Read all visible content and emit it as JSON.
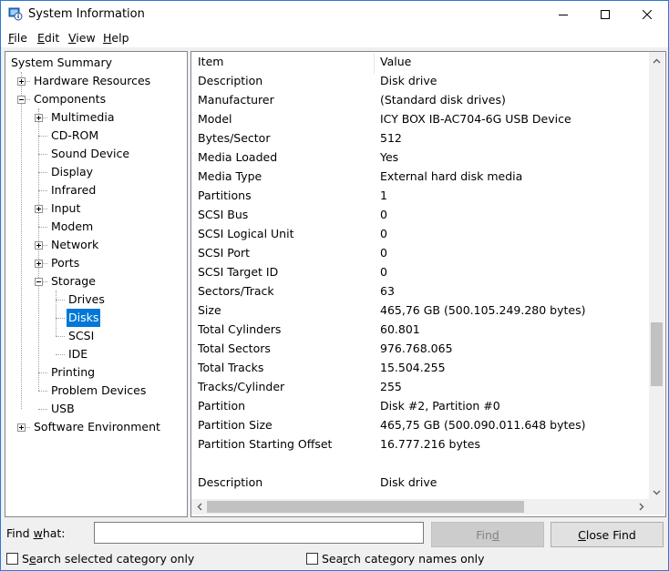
{
  "window": {
    "title": "System Information"
  },
  "menu": [
    "File",
    "Edit",
    "View",
    "Help"
  ],
  "tree": [
    {
      "label": "System Summary"
    },
    {
      "label": "Hardware Resources",
      "expander": "plus"
    },
    {
      "label": "Components",
      "expander": "minus"
    },
    {
      "label": "Multimedia",
      "expander": "plus"
    },
    {
      "label": "CD-ROM"
    },
    {
      "label": "Sound Device"
    },
    {
      "label": "Display"
    },
    {
      "label": "Infrared"
    },
    {
      "label": "Input",
      "expander": "plus"
    },
    {
      "label": "Modem"
    },
    {
      "label": "Network",
      "expander": "plus"
    },
    {
      "label": "Ports",
      "expander": "plus"
    },
    {
      "label": "Storage",
      "expander": "minus"
    },
    {
      "label": "Drives"
    },
    {
      "label": "Disks",
      "selected": true
    },
    {
      "label": "SCSI"
    },
    {
      "label": "IDE"
    },
    {
      "label": "Printing"
    },
    {
      "label": "Problem Devices"
    },
    {
      "label": "USB"
    },
    {
      "label": "Software Environment",
      "expander": "plus"
    }
  ],
  "table": {
    "headers": [
      "Item",
      "Value"
    ],
    "rows": [
      [
        "Description",
        "Disk drive"
      ],
      [
        "Manufacturer",
        "(Standard disk drives)"
      ],
      [
        "Model",
        "ICY BOX IB-AC704-6G USB Device"
      ],
      [
        "Bytes/Sector",
        "512"
      ],
      [
        "Media Loaded",
        "Yes"
      ],
      [
        "Media Type",
        "External hard disk media"
      ],
      [
        "Partitions",
        "1"
      ],
      [
        "SCSI Bus",
        "0"
      ],
      [
        "SCSI Logical Unit",
        "0"
      ],
      [
        "SCSI Port",
        "0"
      ],
      [
        "SCSI Target ID",
        "0"
      ],
      [
        "Sectors/Track",
        "63"
      ],
      [
        "Size",
        "465,76 GB (500.105.249.280 bytes)"
      ],
      [
        "Total Cylinders",
        "60.801"
      ],
      [
        "Total Sectors",
        "976.768.065"
      ],
      [
        "Total Tracks",
        "15.504.255"
      ],
      [
        "Tracks/Cylinder",
        "255"
      ],
      [
        "Partition",
        "Disk #2, Partition #0"
      ],
      [
        "Partition Size",
        "465,75 GB (500.090.011.648 bytes)"
      ],
      [
        "Partition Starting Offset",
        "16.777.216 bytes"
      ],
      [
        "",
        ""
      ],
      [
        "Description",
        "Disk drive"
      ]
    ]
  },
  "find": {
    "label": "Find what:",
    "value": "",
    "find_button": "Find",
    "close_button": "Close Find",
    "search_selected": "Search selected category only",
    "search_names": "Search category names only"
  },
  "colors": {
    "selection": "#0078d7",
    "window_border": "#2b79d6"
  },
  "icons": {
    "app": "system-information-icon",
    "minimize": "minimize-icon",
    "maximize": "maximize-icon",
    "close": "close-icon"
  }
}
